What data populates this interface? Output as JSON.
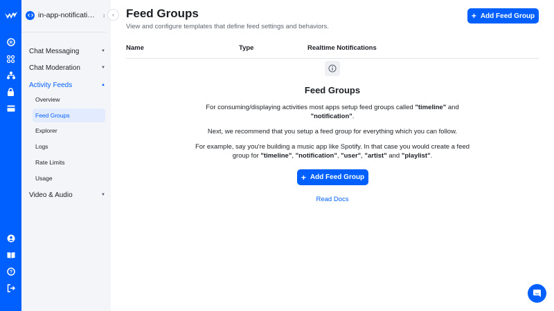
{
  "app_switcher": {
    "name": "in-app-notificatio…"
  },
  "nav": [
    {
      "label": "Chat Messaging"
    },
    {
      "label": "Chat Moderation"
    },
    {
      "label": "Activity Feeds",
      "children": [
        "Overview",
        "Feed Groups",
        "Explorer",
        "Logs",
        "Rate Limits",
        "Usage"
      ]
    },
    {
      "label": "Video & Audio"
    }
  ],
  "header": {
    "title": "Feed Groups",
    "subtitle": "View and configure templates that define feed settings and behaviors.",
    "add_button": "Add Feed Group"
  },
  "table": {
    "columns": [
      "Name",
      "Type",
      "Realtime Notifications"
    ]
  },
  "empty_state": {
    "title": "Feed Groups",
    "para1": {
      "a": "For consuming/displaying activities most apps setup feed groups called ",
      "b1": "\"timeline\"",
      "c": " and ",
      "b2": "\"notification\"",
      "d": "."
    },
    "para2": "Next, we recommend that you setup a feed group for everything which you can follow.",
    "para3": {
      "a": "For example, say you're building a music app like Spotify. In that case you would create a feed group for ",
      "b1": "\"timeline\"",
      "c1": ", ",
      "b2": "\"notification\"",
      "c2": ", ",
      "b3": "\"user\"",
      "c3": ", ",
      "b4": "\"artist\"",
      "c4": " and ",
      "b5": "\"playlist\"",
      "d": "."
    },
    "add_button": "Add Feed Group",
    "read_docs": "Read Docs"
  },
  "colors": {
    "brand": "#005fff",
    "sidebar_bg": "#f3f5f9",
    "active_bg": "#e3ecff"
  },
  "icons": {
    "rail_top": [
      "logo-icon",
      "apps-icon",
      "grid-icon",
      "org-icon",
      "lock-icon",
      "billing-icon"
    ],
    "rail_bottom": [
      "account-icon",
      "docs-icon",
      "help-icon",
      "logout-icon"
    ]
  }
}
